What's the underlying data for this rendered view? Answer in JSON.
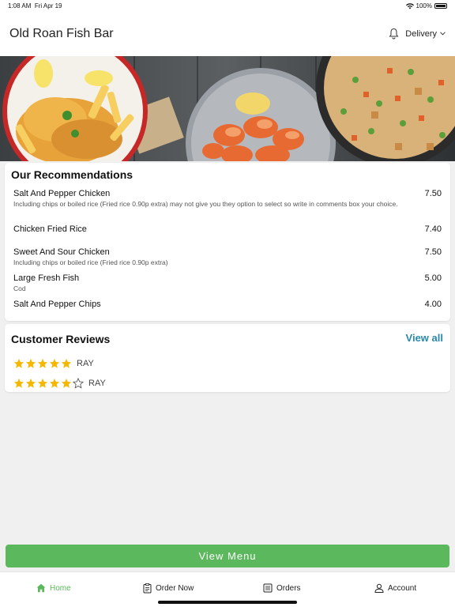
{
  "status_bar": {
    "time": "1:08 AM",
    "date": "Fri Apr 19",
    "battery": "100%"
  },
  "header": {
    "title": "Old Roan Fish Bar",
    "delivery_label": "Delivery"
  },
  "recommendations": {
    "title": "Our Recommendations",
    "items": [
      {
        "name": "Salt And Pepper Chicken",
        "price": "7.50",
        "description": "Including chips or boiled rice (Fried rice 0.90p extra) may not give you they option to select so write in comments box your choice."
      },
      {
        "name": "Chicken Fried Rice",
        "price": "7.40",
        "description": ""
      },
      {
        "name": "Sweet And Sour Chicken",
        "price": "7.50",
        "description": "Including chips or boiled rice (Fried rice 0.90p extra)"
      },
      {
        "name": "Large Fresh Fish",
        "price": "5.00",
        "description": "Cod"
      },
      {
        "name": "Salt And Pepper Chips",
        "price": "4.00",
        "description": ""
      }
    ]
  },
  "reviews": {
    "title": "Customer Reviews",
    "view_all_label": "View all",
    "items": [
      {
        "author": "RAY",
        "rating": 5
      },
      {
        "author": "RAY",
        "rating": 4
      }
    ]
  },
  "view_menu_label": "View Menu",
  "tabs": [
    {
      "label": "Home",
      "icon": "home-icon",
      "active": true
    },
    {
      "label": "Order Now",
      "icon": "order-icon",
      "active": false
    },
    {
      "label": "Orders",
      "icon": "orders-icon",
      "active": false
    },
    {
      "label": "Account",
      "icon": "account-icon",
      "active": false
    }
  ],
  "colors": {
    "accent_green": "#5cb85c",
    "link_blue": "#2b88a8",
    "star_gold": "#f5b800"
  }
}
